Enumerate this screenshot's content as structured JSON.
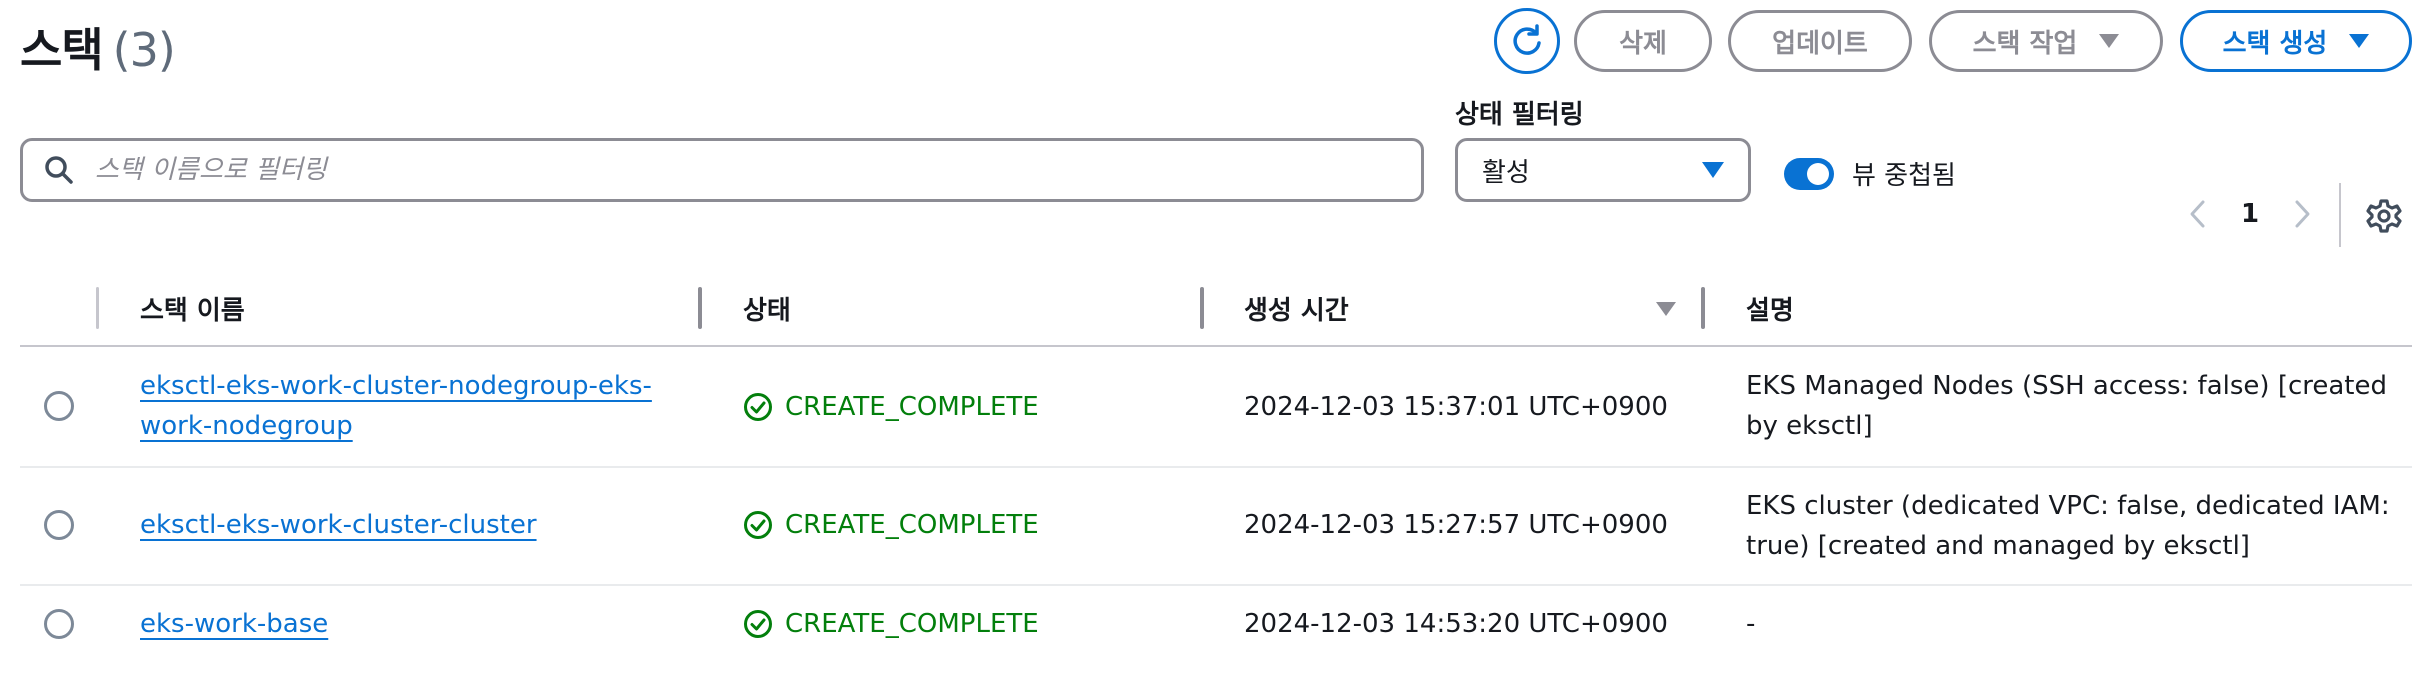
{
  "header": {
    "title": "스택",
    "count": "(3)",
    "buttons": {
      "delete": "삭제",
      "update": "업데이트",
      "stack_actions": "스택 작업",
      "create_stack": "스택 생성"
    }
  },
  "filters": {
    "search_placeholder": "스택 이름으로 필터링",
    "search_value": "",
    "status_filter_label": "상태 필터링",
    "status_filter_value": "활성",
    "nested_view_label": "뷰 중첩됨",
    "nested_view_on": true
  },
  "pagination": {
    "current_page": "1"
  },
  "table": {
    "columns": [
      "스택 이름",
      "상태",
      "생성 시간",
      "설명"
    ],
    "rows": [
      {
        "name_line1": "eksctl-eks-work-cluster-nodegroup-eks-",
        "name_line2": "work-nodegroup",
        "status": "CREATE_COMPLETE",
        "created": "2024-12-03 15:37:01 UTC+0900",
        "desc_line1": "EKS Managed Nodes (SSH access: false) [created",
        "desc_line2": "by eksctl]"
      },
      {
        "name_line1": "eksctl-eks-work-cluster-cluster",
        "status": "CREATE_COMPLETE",
        "created": "2024-12-03 15:27:57 UTC+0900",
        "desc_line1": "EKS cluster (dedicated VPC: false, dedicated IAM:",
        "desc_line2": "true) [created and managed by eksctl]"
      },
      {
        "name_line1": "eks-work-base",
        "status": "CREATE_COMPLETE",
        "created": "2024-12-03 14:53:20 UTC+0900",
        "desc_line1": "-"
      }
    ]
  },
  "colors": {
    "accent": "#0972d3",
    "success": "#037f0c",
    "disabled": "#8c8c94"
  },
  "icons": {
    "refresh": "refresh-icon",
    "search": "search-icon",
    "success": "check-circle-icon",
    "settings": "gear-icon",
    "sort": "sort-down-icon"
  }
}
